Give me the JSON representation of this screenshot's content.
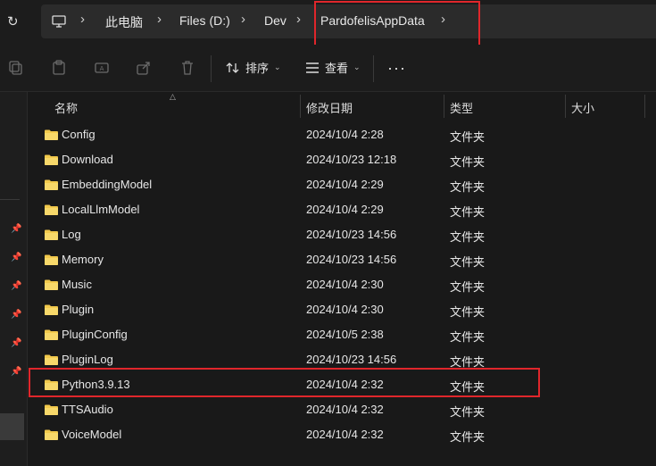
{
  "address_bar": {
    "breadcrumbs": [
      "此电脑",
      "Files (D:)",
      "Dev",
      "PardofelisAppData"
    ],
    "refresh_icon": "refresh-icon",
    "computer_icon": "computer-icon"
  },
  "toolbar": {
    "sort_label": "排序",
    "view_label": "查看",
    "more_label": "···",
    "icons": [
      "copy-icon",
      "paste-icon",
      "rename-icon",
      "share-icon",
      "delete-icon"
    ]
  },
  "columns": {
    "name": "名称",
    "modified": "修改日期",
    "type": "类型",
    "size": "大小"
  },
  "files": [
    {
      "name": "Config",
      "modified": "2024/10/4 2:28",
      "type": "文件夹"
    },
    {
      "name": "Download",
      "modified": "2024/10/23 12:18",
      "type": "文件夹"
    },
    {
      "name": "EmbeddingModel",
      "modified": "2024/10/4 2:29",
      "type": "文件夹"
    },
    {
      "name": "LocalLlmModel",
      "modified": "2024/10/4 2:29",
      "type": "文件夹"
    },
    {
      "name": "Log",
      "modified": "2024/10/23 14:56",
      "type": "文件夹"
    },
    {
      "name": "Memory",
      "modified": "2024/10/23 14:56",
      "type": "文件夹"
    },
    {
      "name": "Music",
      "modified": "2024/10/4 2:30",
      "type": "文件夹"
    },
    {
      "name": "Plugin",
      "modified": "2024/10/4 2:30",
      "type": "文件夹"
    },
    {
      "name": "PluginConfig",
      "modified": "2024/10/5 2:38",
      "type": "文件夹"
    },
    {
      "name": "PluginLog",
      "modified": "2024/10/23 14:56",
      "type": "文件夹"
    },
    {
      "name": "Python3.9.13",
      "modified": "2024/10/4 2:32",
      "type": "文件夹"
    },
    {
      "name": "TTSAudio",
      "modified": "2024/10/4 2:32",
      "type": "文件夹"
    },
    {
      "name": "VoiceModel",
      "modified": "2024/10/4 2:32",
      "type": "文件夹"
    }
  ],
  "colors": {
    "highlight_box": "#e0262b",
    "folder": "#f2c94c",
    "background": "#191919"
  }
}
